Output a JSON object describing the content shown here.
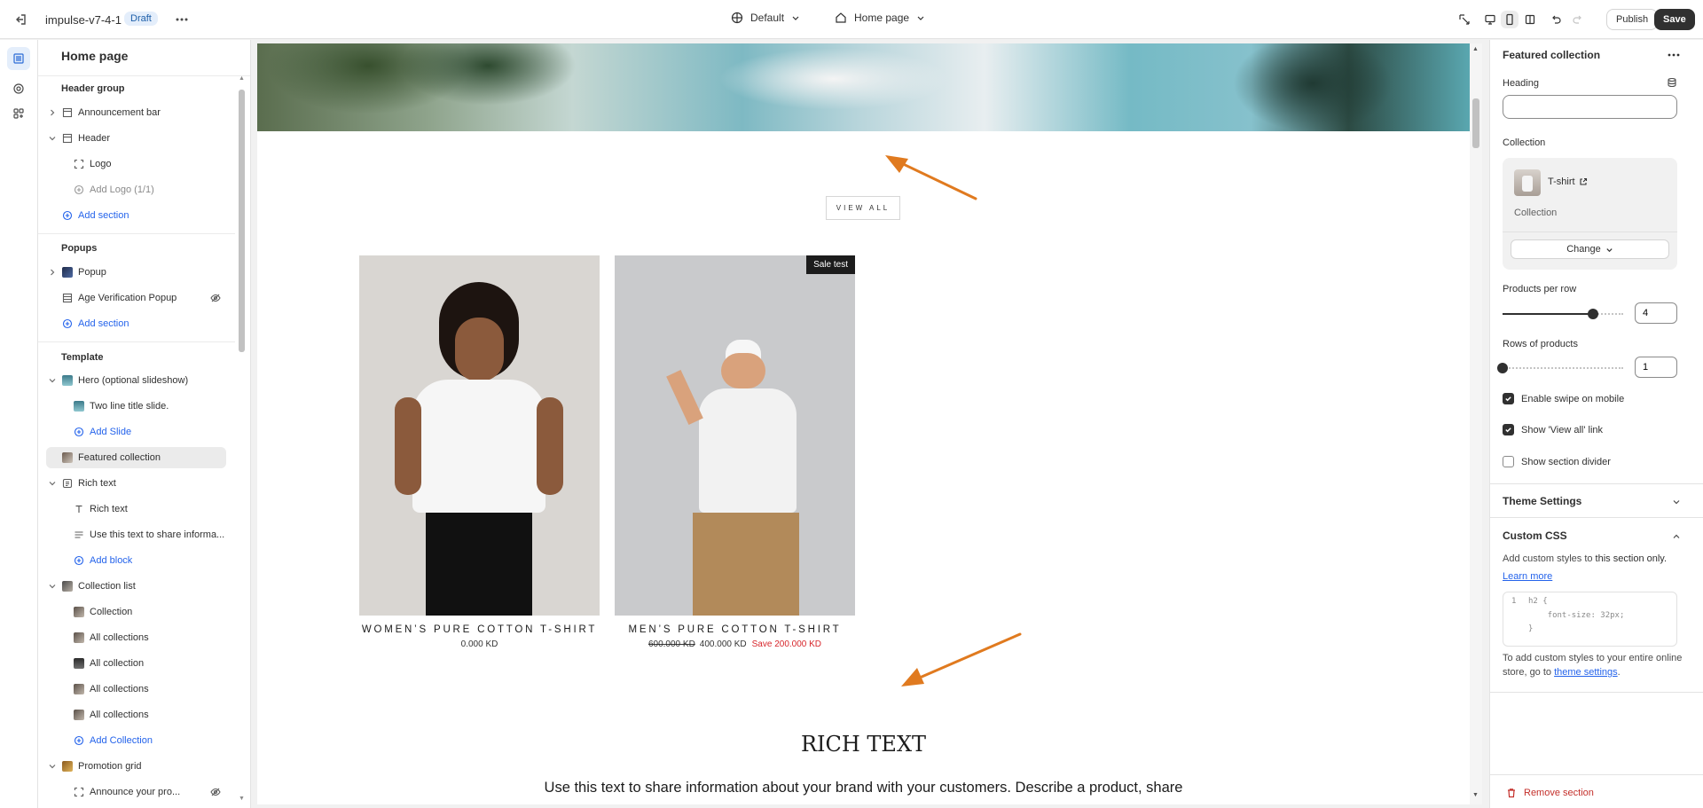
{
  "topbar": {
    "store_name": "impulse-v7-4-1",
    "status_badge": "Draft",
    "theme_selector": "Default",
    "page_selector": "Home page",
    "publish_label": "Publish",
    "save_label": "Save"
  },
  "rail": {
    "items": [
      "sections-icon",
      "settings-icon",
      "apps-icon"
    ],
    "active": "sections-icon"
  },
  "left_panel": {
    "title": "Home page",
    "header_group": {
      "label": "Header group",
      "items": [
        {
          "label": "Announcement bar",
          "icon": "section-icon",
          "expandable": "collapsed"
        },
        {
          "label": "Header",
          "icon": "section-icon",
          "expandable": "expanded"
        },
        {
          "label": "Logo",
          "icon": "logo-block-icon"
        },
        {
          "label": "Add Logo (1/1)",
          "icon": "add-circle-icon",
          "muted": true
        },
        {
          "label": "Add section",
          "icon": "add-circle-icon",
          "add": true
        }
      ]
    },
    "popups": {
      "label": "Popups",
      "items": [
        {
          "label": "Popup",
          "icon": "popup-thumb",
          "expandable": "collapsed"
        },
        {
          "label": "Age Verification Popup",
          "icon": "section-icon",
          "hidden": true
        },
        {
          "label": "Add section",
          "icon": "add-circle-icon",
          "add": true
        }
      ]
    },
    "template": {
      "label": "Template",
      "items": [
        {
          "label": "Hero (optional slideshow)",
          "icon": "image-thumb",
          "expandable": "expanded"
        },
        {
          "label": "Two line title slide.",
          "icon": "image-thumb"
        },
        {
          "label": "Add Slide",
          "icon": "add-circle-icon",
          "add": true
        },
        {
          "label": "Featured collection",
          "icon": "collection-thumb",
          "selected": true
        },
        {
          "label": "Rich text",
          "icon": "rich-text-icon",
          "expandable": "expanded"
        },
        {
          "label": "Rich text",
          "icon": "text-icon"
        },
        {
          "label": "Use this text to share informa...",
          "icon": "paragraph-icon"
        },
        {
          "label": "Add block",
          "icon": "add-circle-icon",
          "add": true
        },
        {
          "label": "Collection list",
          "icon": "collection-list-thumb",
          "expandable": "expanded"
        },
        {
          "label": "Collection",
          "icon": "collection-thumb"
        },
        {
          "label": "All collections",
          "icon": "collection-thumb"
        },
        {
          "label": "All collection",
          "icon": "collection-thumb-dark"
        },
        {
          "label": "All collections",
          "icon": "collection-thumb"
        },
        {
          "label": "All collections",
          "icon": "collection-thumb"
        },
        {
          "label": "Add Collection",
          "icon": "add-circle-icon",
          "add": true
        },
        {
          "label": "Promotion grid",
          "icon": "promotion-thumb",
          "expandable": "expanded"
        },
        {
          "label": "Announce your pro...",
          "icon": "logo-block-icon",
          "hidden": true
        }
      ]
    }
  },
  "preview": {
    "view_all_label": "VIEW ALL",
    "products": [
      {
        "name": "WOMEN’S PURE COTTON T-SHIRT",
        "price": "0.000 KD"
      },
      {
        "name": "MEN’S PURE COTTON T-SHIRT",
        "compare_price": "600.000 KD",
        "price": "400.000 KD",
        "save": "Save 200.000 KD",
        "badge": "Sale test"
      }
    ],
    "rich_text_heading": "RICH TEXT",
    "rich_text_body": "Use this text to share information about your brand with your customers. Describe a product, share",
    "arrow_color": "#e07a1f"
  },
  "right_panel": {
    "title": "Featured collection",
    "heading_label": "Heading",
    "heading_value": "",
    "collection_label": "Collection",
    "collection_name": "T-shirt",
    "collection_type": "Collection",
    "change_label": "Change",
    "products_per_row_label": "Products per row",
    "products_per_row_value": "4",
    "products_per_row_fraction": 0.75,
    "rows_label": "Rows of products",
    "rows_value": "1",
    "rows_fraction": 0,
    "checkboxes": [
      {
        "label": "Enable swipe on mobile",
        "checked": true
      },
      {
        "label": "Show 'View all' link",
        "checked": true
      },
      {
        "label": "Show section divider",
        "checked": false
      }
    ],
    "theme_settings_label": "Theme Settings",
    "custom_css_label": "Custom CSS",
    "custom_css_help_prefix": "Add custom styles to ",
    "custom_css_help_bold": "this section only.",
    "learn_more": "Learn more",
    "code_line_number": "1",
    "code_lines": [
      "h2 {",
      "    font-size: 32px;",
      "}"
    ],
    "footer_help_prefix": "To add custom styles to your entire online store, go to ",
    "footer_help_link": "theme settings",
    "footer_help_suffix": ".",
    "remove_label": "Remove section",
    "danger_color": "#c4302b",
    "accent_color": "#2463eb"
  }
}
